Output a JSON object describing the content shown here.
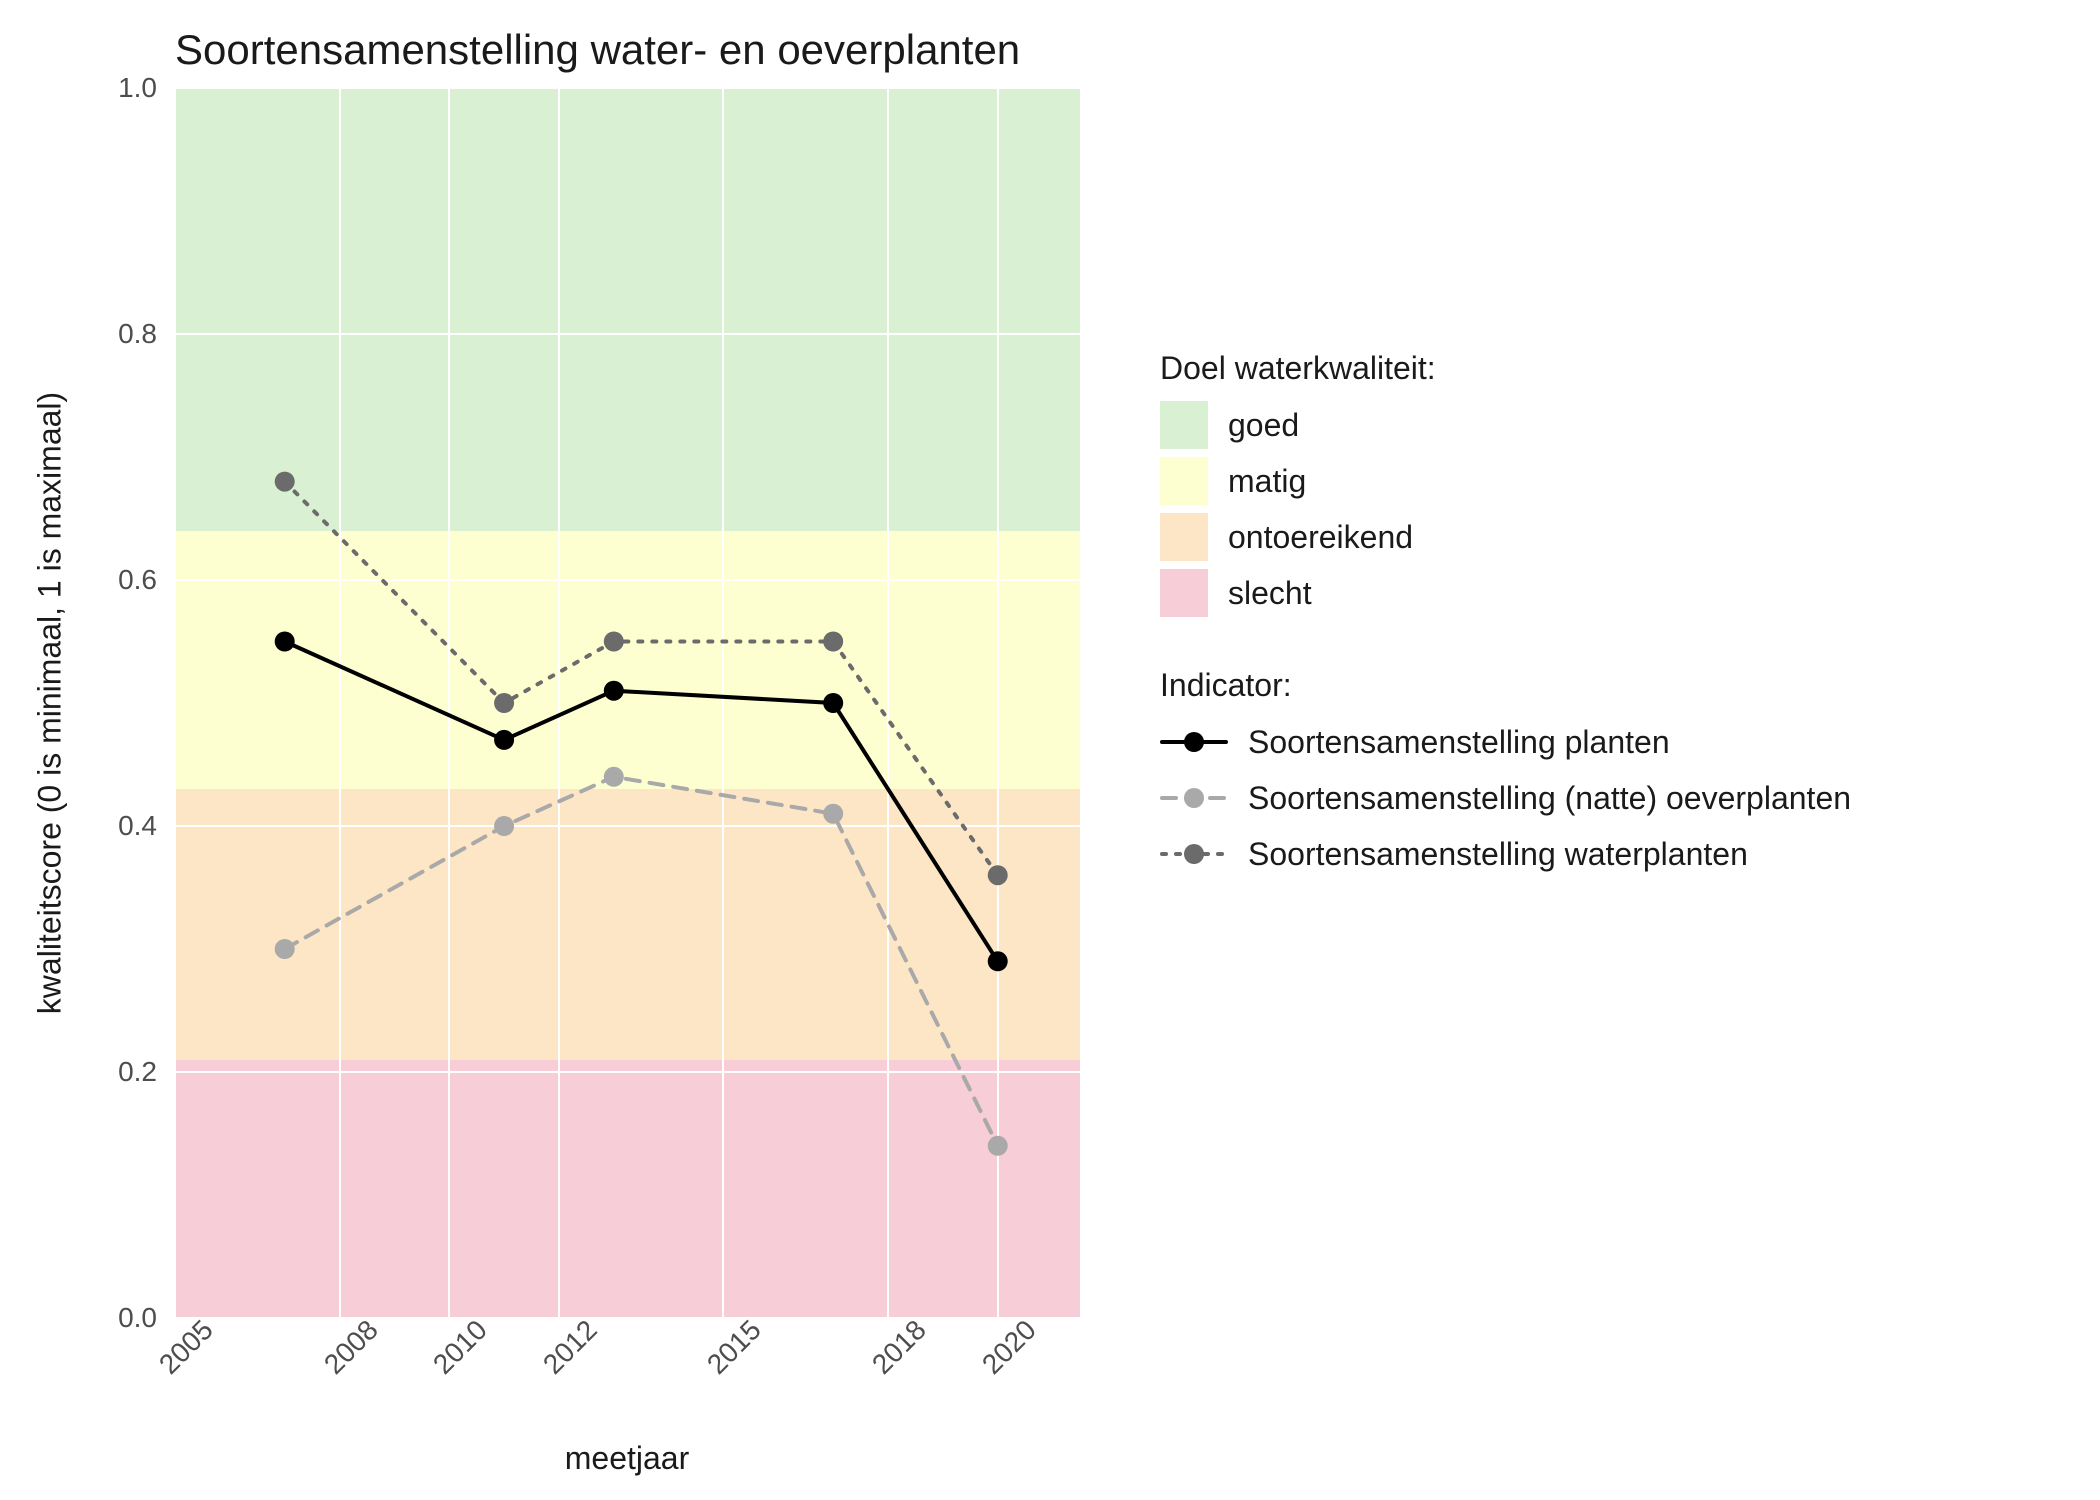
{
  "chart_data": {
    "type": "line",
    "title": "Soortensamenstelling water- en oeverplanten",
    "xlabel": "meetjaar",
    "ylabel": "kwaliteitscore (0 is minimaal, 1 is maximaal)",
    "x_ticks": [
      2005,
      2008,
      2010,
      2012,
      2015,
      2018,
      2020
    ],
    "y_ticks": [
      0.0,
      0.2,
      0.4,
      0.6,
      0.8,
      1.0
    ],
    "xlim": [
      2005,
      2021.5
    ],
    "ylim": [
      0.0,
      1.0
    ],
    "x": [
      2007,
      2011,
      2013,
      2017,
      2020
    ],
    "series": [
      {
        "name": "Soortensamenstelling planten",
        "style": "solid",
        "color": "#000000",
        "values": [
          0.55,
          0.47,
          0.51,
          0.5,
          0.29
        ]
      },
      {
        "name": "Soortensamenstelling (natte) oeverplanten",
        "style": "dashed",
        "color": "#a9a9a9",
        "values": [
          0.3,
          0.4,
          0.44,
          0.41,
          0.14
        ]
      },
      {
        "name": "Soortensamenstelling waterplanten",
        "style": "dotted",
        "color": "#6b6b6b",
        "values": [
          0.68,
          0.5,
          0.55,
          0.55,
          0.36
        ]
      }
    ],
    "bands": [
      {
        "name": "goed",
        "color": "#d9f0d3",
        "from": 0.64,
        "to": 1.0
      },
      {
        "name": "matig",
        "color": "#feffd1",
        "from": 0.43,
        "to": 0.64
      },
      {
        "name": "ontoereikend",
        "color": "#fde6c5",
        "from": 0.21,
        "to": 0.43
      },
      {
        "name": "slecht",
        "color": "#f7cdd7",
        "from": 0.0,
        "to": 0.21
      }
    ],
    "legend_titles": {
      "bands": "Doel waterkwaliteit:",
      "series": "Indicator:"
    }
  }
}
